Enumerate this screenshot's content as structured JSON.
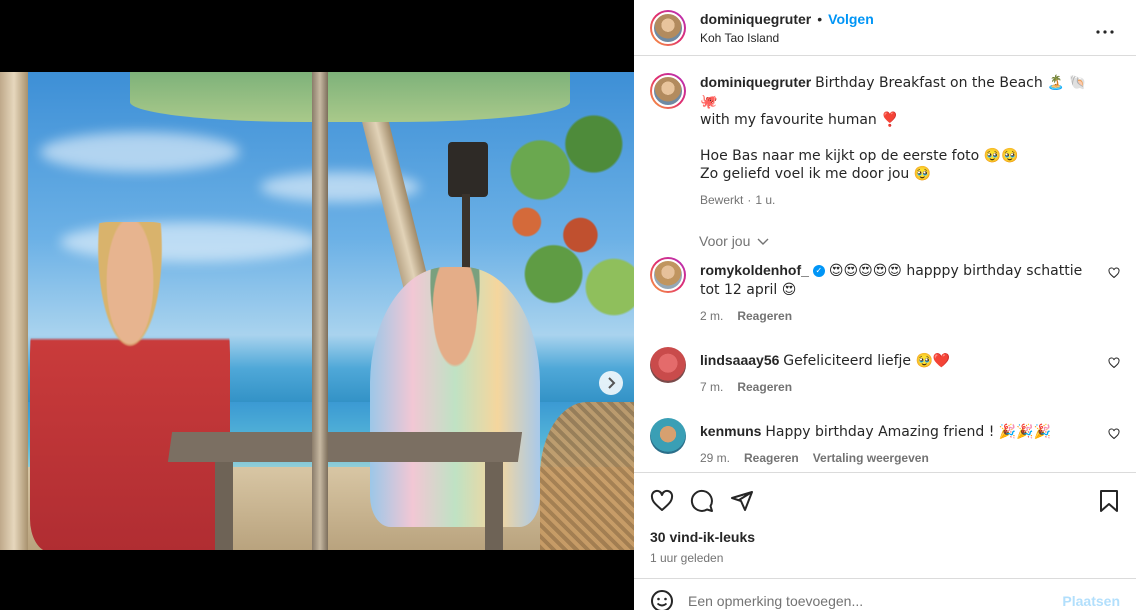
{
  "post": {
    "username": "dominiquegruter",
    "follow_label": "Volgen",
    "location": "Koh Tao Island",
    "separator": "•"
  },
  "caption": {
    "username": "dominiquegruter",
    "line1": "Birthday Breakfast on the Beach 🏝️ 🐚🐙",
    "line2": "with my favourite human ❣️",
    "line3": "Hoe Bas naar me kijkt op de eerste foto 🥹🥹",
    "line4": "Zo geliefd voel ik me door jou 🥹",
    "edited": "Bewerkt",
    "time": "1 u."
  },
  "voor_jou": "Voor jou",
  "comments": [
    {
      "username": "romykoldenhof_",
      "text": "😍😍😍😍😍 happpy birthday schattie tot 12 april 😍",
      "time": "2 m.",
      "reply": "Reageren",
      "translate": ""
    },
    {
      "username": "lindsaaay56",
      "text": "Gefeliciteerd liefje 🥹❤️",
      "time": "7 m.",
      "reply": "Reageren",
      "translate": ""
    },
    {
      "username": "kenmuns",
      "text": "Happy birthday Amazing friend ! 🎉🎉🎉",
      "time": "29 m.",
      "reply": "Reageren",
      "translate": "Vertaling weergeven"
    }
  ],
  "likes": "30 vind-ik-leuks",
  "posted": "1 uur geleden",
  "comment_input": {
    "placeholder": "Een opmerking toevoegen...",
    "post_label": "Plaatsen"
  },
  "icons": {
    "more": "more-options-icon",
    "like": "heart-icon",
    "comment": "comment-icon",
    "share": "share-icon",
    "save": "bookmark-icon",
    "emoji": "emoji-icon",
    "next": "chevron-right-icon",
    "user_tag": "user-tag-icon"
  },
  "colors": {
    "accent": "#0095f6",
    "text": "#262626",
    "muted": "#737373"
  }
}
